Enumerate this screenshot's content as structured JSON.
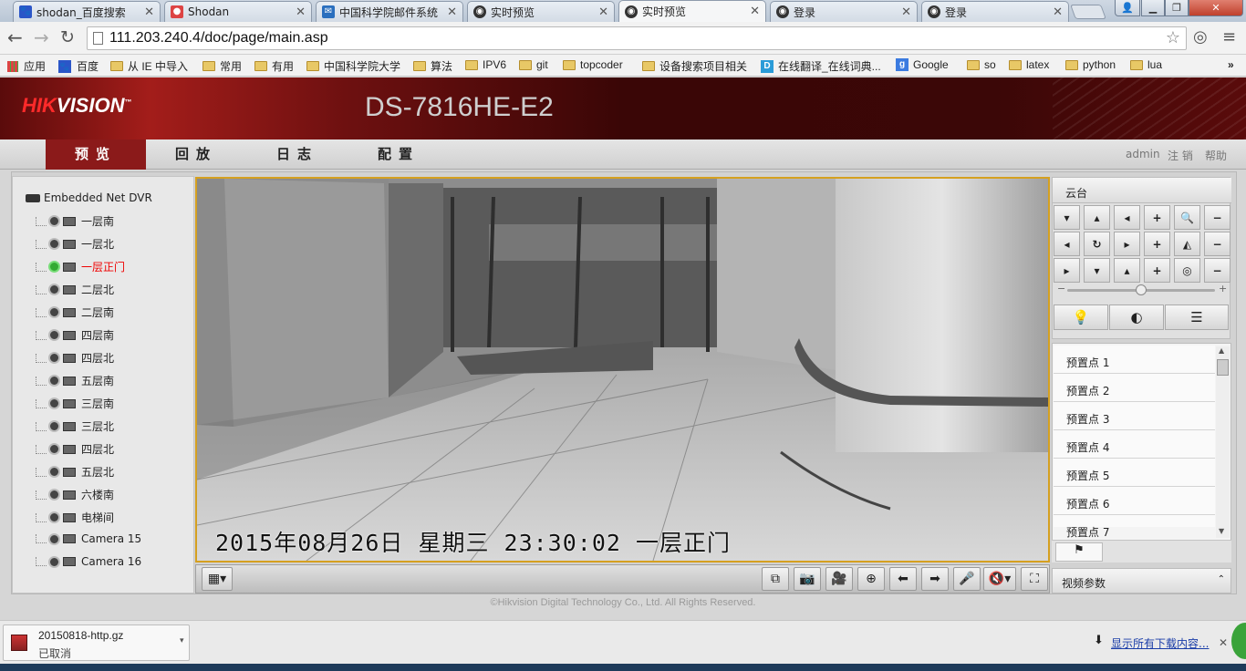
{
  "browser": {
    "tabs": [
      {
        "label": "shodan_百度搜索",
        "icon": "baidu-paw-icon",
        "active": false
      },
      {
        "label": "Shodan",
        "icon": "shodan-icon",
        "active": false
      },
      {
        "label": "中国科学院邮件系统",
        "icon": "mail-icon",
        "active": false
      },
      {
        "label": "实时预览",
        "icon": "camera-lens-icon",
        "active": false
      },
      {
        "label": "实时预览",
        "icon": "camera-lens-icon",
        "active": true
      },
      {
        "label": "登录",
        "icon": "camera-lens-icon",
        "active": false
      },
      {
        "label": "登录",
        "icon": "camera-lens-icon",
        "active": false
      }
    ],
    "url": "111.203.240.4/doc/page/main.asp",
    "bookmarks": [
      {
        "label": "应用",
        "icon": "apps-grid-icon"
      },
      {
        "label": "百度",
        "icon": "baidu-paw-icon"
      },
      {
        "label": "从 IE 中导入",
        "icon": "folder-icon"
      },
      {
        "label": "常用",
        "icon": "folder-icon"
      },
      {
        "label": "有用",
        "icon": "folder-icon"
      },
      {
        "label": "中国科学院大学",
        "icon": "folder-icon"
      },
      {
        "label": "算法",
        "icon": "folder-icon"
      },
      {
        "label": "IPV6",
        "icon": "folder-icon"
      },
      {
        "label": "git",
        "icon": "folder-icon"
      },
      {
        "label": "topcoder",
        "icon": "folder-icon"
      },
      {
        "label": "设备搜索项目相关",
        "icon": "folder-icon"
      },
      {
        "label": "在线翻译_在线词典...",
        "icon": "dict-icon"
      },
      {
        "label": "Google",
        "icon": "google-icon"
      },
      {
        "label": "so",
        "icon": "folder-icon"
      },
      {
        "label": "latex",
        "icon": "folder-icon"
      },
      {
        "label": "python",
        "icon": "folder-icon"
      },
      {
        "label": "lua",
        "icon": "folder-icon"
      }
    ]
  },
  "header": {
    "brand_red": "HIK",
    "brand_white": "VISION",
    "model": "DS-7816HE-E2"
  },
  "menu": {
    "items": [
      "预览",
      "回放",
      "日志",
      "配置"
    ],
    "active": "预览",
    "user": "admin",
    "logout": "注 销",
    "help": "帮助"
  },
  "tree": {
    "root": "Embedded Net DVR",
    "cameras": [
      {
        "label": "一层南",
        "selected": false
      },
      {
        "label": "一层北",
        "selected": false
      },
      {
        "label": "一层正门",
        "selected": true
      },
      {
        "label": "二层北",
        "selected": false
      },
      {
        "label": "二层南",
        "selected": false
      },
      {
        "label": "四层南",
        "selected": false
      },
      {
        "label": "四层北",
        "selected": false
      },
      {
        "label": "五层南",
        "selected": false
      },
      {
        "label": "三层南",
        "selected": false
      },
      {
        "label": "三层北",
        "selected": false
      },
      {
        "label": "四层北",
        "selected": false
      },
      {
        "label": "五层北",
        "selected": false
      },
      {
        "label": "六楼南",
        "selected": false
      },
      {
        "label": "电梯间",
        "selected": false
      },
      {
        "label": "Camera 15",
        "selected": false
      },
      {
        "label": "Camera 16",
        "selected": false
      }
    ]
  },
  "video": {
    "osd": "2015年08月26日 星期三 23:30:02 一层正门"
  },
  "ptz": {
    "title": "云台",
    "presets": [
      "预置点 1",
      "预置点 2",
      "预置点 3",
      "预置点 4",
      "预置点 5",
      "预置点 6",
      "预置点 7"
    ],
    "video_params": "视频参数"
  },
  "footer": {
    "copyright": "©Hikvision Digital Technology Co., Ltd. All Rights Reserved."
  },
  "downloads": {
    "file": "20150818-http.gz",
    "status": "已取消",
    "show_all": "显示所有下载内容..."
  },
  "colors": {
    "brand_red": "#8b1a1a",
    "selected_text": "#ee0000",
    "video_border": "#d5a020"
  }
}
